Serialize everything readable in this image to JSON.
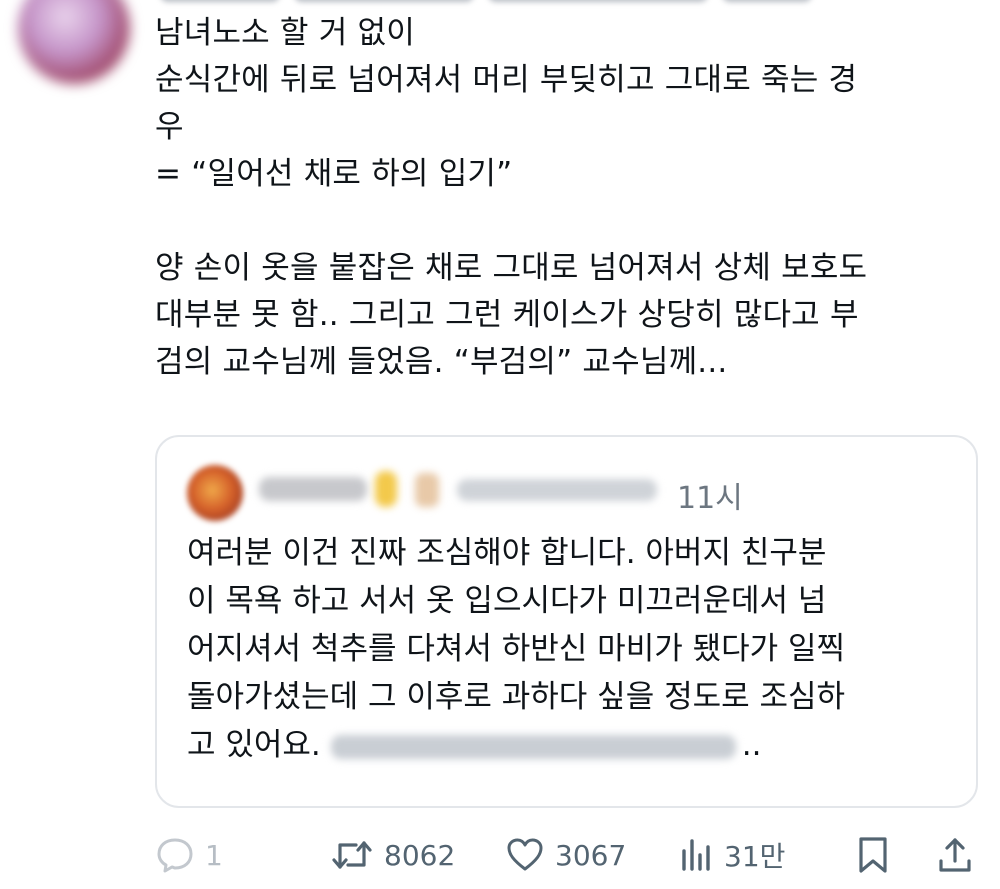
{
  "post": {
    "lines": [
      "남녀노소 할 거 없이",
      "순식간에 뒤로 넘어져서 머리 부딪히고 그대로 죽는 경",
      "우",
      "= “일어선 채로 하의 입기”",
      "",
      "양 손이 옷을 붙잡은 채로 그대로 넘어져서 상체 보호도",
      "대부분 못 함.. 그리고 그런 케이스가 상당히 많다고 부",
      "검의 교수님께 들었음. “부검의” 교수님께..."
    ]
  },
  "quote": {
    "time": "11시",
    "lines": [
      "여러분 이건 진짜 조심해야 합니다. 아버지 친구분",
      "이 목욕 하고 서서 옷 입으시다가 미끄러운데서 넘",
      "어지셔서 척추를 다쳐서 하반신 마비가 됐다가 일찍",
      "돌아가셨는데 그 이후로 과하다 싶을 정도로 조심하"
    ],
    "last_line_start": "고 있어요.",
    "last_line_end": ".."
  },
  "actions": {
    "reply_count": "1",
    "repost_count": "8062",
    "like_count": "3067",
    "views_count": "31만",
    "icons": {
      "reply": "reply-icon",
      "repost": "repost-icon",
      "like": "heart-icon",
      "views": "views-icon",
      "bookmark": "bookmark-icon",
      "share": "share-icon"
    },
    "icon_color": "#536471"
  }
}
